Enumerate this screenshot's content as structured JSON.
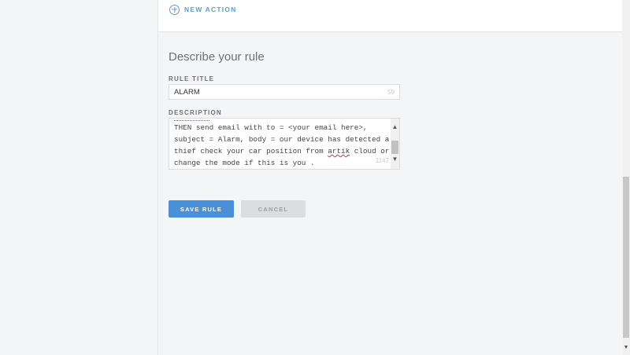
{
  "actions": {
    "new_action_label": "NEW ACTION"
  },
  "rule": {
    "section_title": "Describe your rule",
    "title_label": "RULE TITLE",
    "title_value": "ALARM",
    "title_char_count": "59",
    "description_label": "DESCRIPTION",
    "description_lines": [
      "THEN send email with to = <your email here>,",
      "subject = Alarm, body = our device has detected a",
      "thief check your car position from artik cloud or",
      "change the mode if this is you ."
    ],
    "description_char_count": "1147"
  },
  "buttons": {
    "save": "SAVE RULE",
    "cancel": "CANCEL"
  },
  "colors": {
    "accent": "#4a90d9",
    "icon_blue": "#5b9bd5",
    "cancel_bg": "#dcdde0"
  },
  "icons": {
    "new_action": "plus-circle-icon",
    "scroll_up": "chevron-up-icon",
    "scroll_down": "chevron-down-icon"
  }
}
